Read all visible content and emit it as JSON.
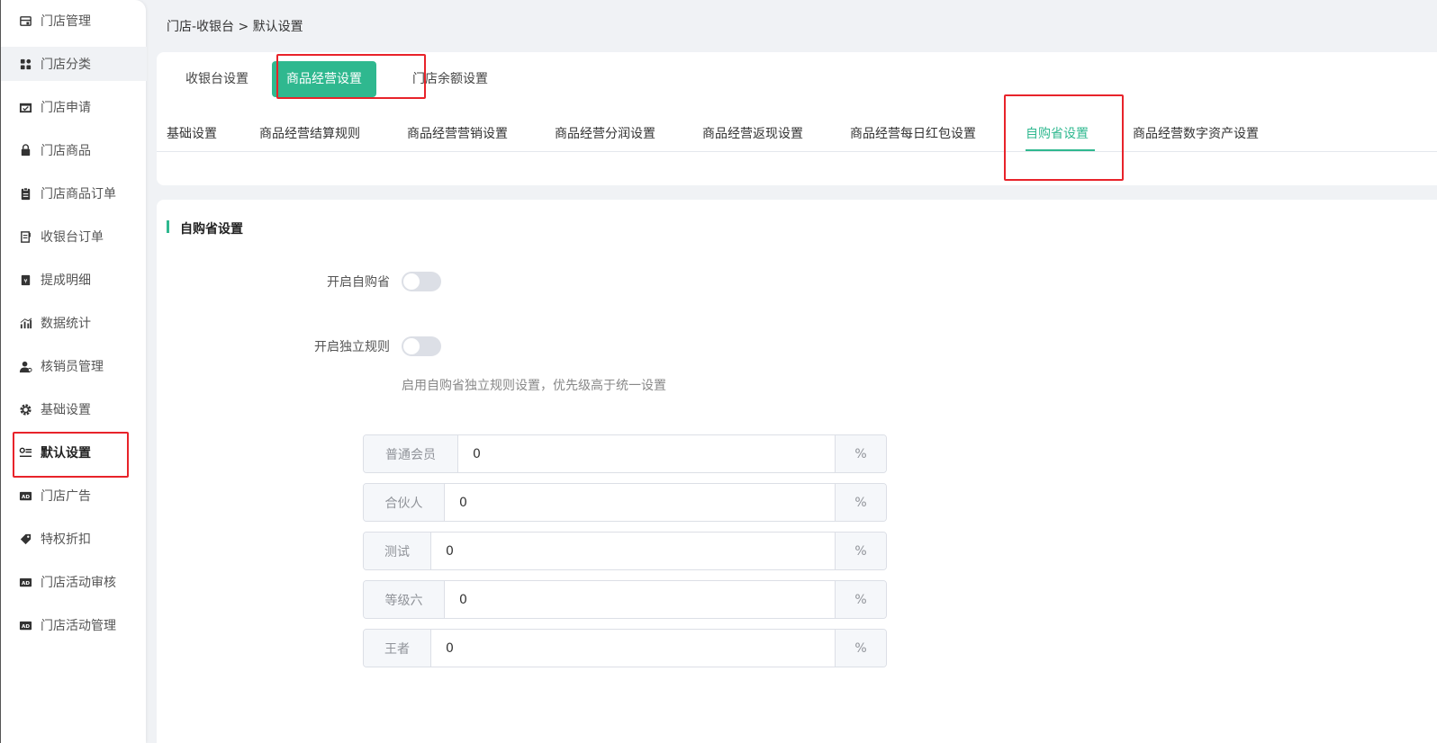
{
  "sidebar": {
    "items": [
      {
        "label": "门店管理",
        "icon": "store-icon"
      },
      {
        "label": "门店分类",
        "icon": "category-icon"
      },
      {
        "label": "门店申请",
        "icon": "inbox-icon"
      },
      {
        "label": "门店商品",
        "icon": "bag-icon"
      },
      {
        "label": "门店商品订单",
        "icon": "clipboard-icon"
      },
      {
        "label": "收银台订单",
        "icon": "receipt-icon"
      },
      {
        "label": "提成明细",
        "icon": "ledger-icon"
      },
      {
        "label": "数据统计",
        "icon": "chart-icon"
      },
      {
        "label": "核销员管理",
        "icon": "user-icon"
      },
      {
        "label": "基础设置",
        "icon": "gear-icon"
      },
      {
        "label": "默认设置",
        "icon": "settings-list-icon"
      },
      {
        "label": "门店广告",
        "icon": "ad-icon"
      },
      {
        "label": "特权折扣",
        "icon": "tag-icon"
      },
      {
        "label": "门店活动审核",
        "icon": "ad-icon"
      },
      {
        "label": "门店活动管理",
        "icon": "ad-icon"
      }
    ]
  },
  "breadcrumb": "门店-收银台 > 默认设置",
  "top_tabs": [
    "收银台设置",
    "商品经营设置",
    "门店余额设置"
  ],
  "sub_tabs": [
    "基础设置",
    "商品经营结算规则",
    "商品经营营销设置",
    "商品经营分润设置",
    "商品经营返现设置",
    "商品经营每日红包设置",
    "自购省设置",
    "商品经营数字资产设置"
  ],
  "section_title": "自购省设置",
  "form": {
    "enable_label": "开启自购省",
    "independent_label": "开启独立规则",
    "hint": "启用自购省独立规则设置，优先级高于统一设置",
    "levels": [
      {
        "name": "普通会员",
        "value": "0",
        "unit": "%"
      },
      {
        "name": "合伙人",
        "value": "0",
        "unit": "%"
      },
      {
        "name": "测试",
        "value": "0",
        "unit": "%"
      },
      {
        "name": "等级六",
        "value": "0",
        "unit": "%"
      },
      {
        "name": "王者",
        "value": "0",
        "unit": "%"
      }
    ]
  },
  "colors": {
    "accent": "#2fb88f",
    "highlight": "#e8232a"
  }
}
